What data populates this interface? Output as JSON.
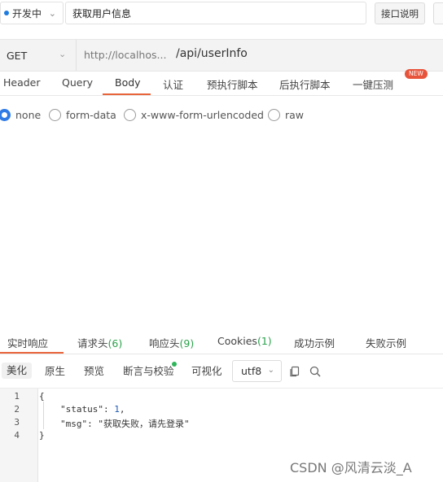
{
  "top": {
    "status_label": "开发中",
    "api_name": "获取用户信息",
    "doc_button": "接口说明"
  },
  "request": {
    "method": "GET",
    "url_prefix": "http://localhos...",
    "url_path": "/api/userInfo"
  },
  "req_tabs": [
    "Header",
    "Query",
    "Body",
    "认证",
    "预执行脚本",
    "后执行脚本",
    "一键压测"
  ],
  "req_tab_active": "Body",
  "new_badge": "NEW",
  "body_types": {
    "options": [
      "none",
      "form-data",
      "x-www-form-urlencoded",
      "raw"
    ],
    "selected": "none"
  },
  "resp_tabs": {
    "realtime": "实时响应",
    "req_headers": "请求头",
    "req_headers_count": "(6)",
    "resp_headers": "响应头",
    "resp_headers_count": "(9)",
    "cookies": "Cookies",
    "cookies_count": "(1)",
    "success_example": "成功示例",
    "fail_example": "失败示例"
  },
  "view_modes": [
    "美化",
    "原生",
    "预览",
    "断言与校验",
    "可视化"
  ],
  "view_mode_active": "美化",
  "encoding": "utf8",
  "code": {
    "line_numbers": [
      "1",
      "2",
      "3",
      "4"
    ],
    "open_brace": "{",
    "status_key": "\"status\"",
    "status_value": "1",
    "msg_key": "\"msg\"",
    "msg_value": "\"获取失败，请先登录\"",
    "close_brace": "}"
  },
  "watermark": "CSDN @风清云淡_A",
  "colors": {
    "accent": "#e8643b",
    "radio_checked": "#2f7be5",
    "count_green": "#2aa24a",
    "new_badge": "#e8543b"
  }
}
